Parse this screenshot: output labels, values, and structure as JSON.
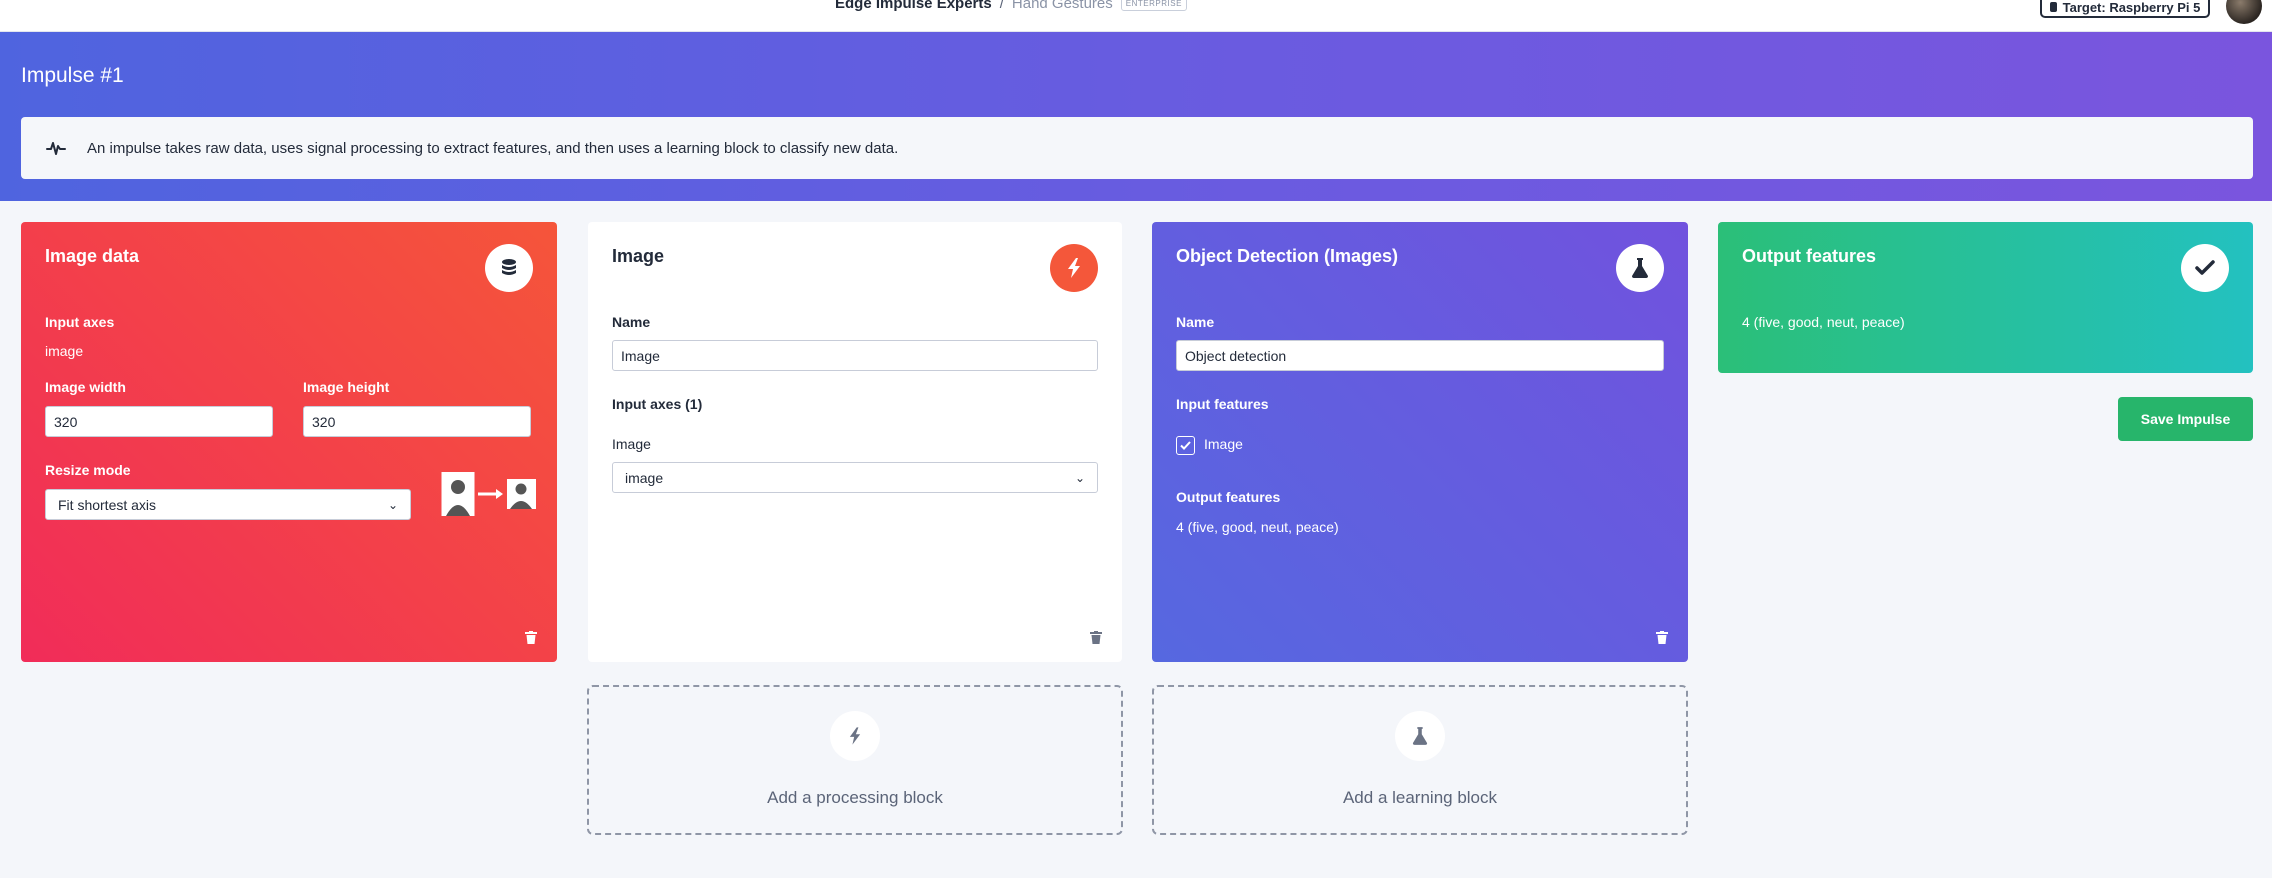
{
  "topbar": {
    "project": "Edge Impulse Experts",
    "separator": "/",
    "subproject": "Hand Gestures",
    "badge": "ENTERPRISE",
    "target_button": "Target: Raspberry Pi 5"
  },
  "hero": {
    "title": "Impulse #1",
    "info": "An impulse takes raw data, uses signal processing to extract features, and then uses a learning block to classify new data."
  },
  "image_data_block": {
    "title": "Image data",
    "input_axes_label": "Input axes",
    "input_axes_value": "image",
    "width_label": "Image width",
    "width_value": "320",
    "height_label": "Image height",
    "height_value": "320",
    "resize_label": "Resize mode",
    "resize_value": "Fit shortest axis"
  },
  "processing_block": {
    "title": "Image",
    "name_label": "Name",
    "name_value": "Image",
    "input_axes_label": "Input axes (1)",
    "axis_label": "Image",
    "axis_value": "image"
  },
  "learning_block": {
    "title": "Object Detection (Images)",
    "name_label": "Name",
    "name_value": "Object detection",
    "input_features_label": "Input features",
    "input_feature": "Image",
    "output_features_label": "Output features",
    "output_features_value": "4 (five, good, neut, peace)"
  },
  "output_block": {
    "title": "Output features",
    "value": "4 (five, good, neut, peace)"
  },
  "actions": {
    "add_processing": "Add a processing block",
    "add_learning": "Add a learning block",
    "save": "Save Impulse"
  },
  "icons": {
    "info": "waveform-icon",
    "image_data": "database-icon",
    "processing": "bolt-icon",
    "learning": "flask-icon",
    "output": "check-icon",
    "delete": "trash-icon"
  },
  "colors": {
    "hero_start": "#4f64df",
    "hero_end": "#7a55de",
    "input_block": "#f12c59",
    "processing_accent": "#f4573a",
    "learning_block": "#6a5be0",
    "output_block": "#2bbf78",
    "save_button": "#27b56b"
  }
}
